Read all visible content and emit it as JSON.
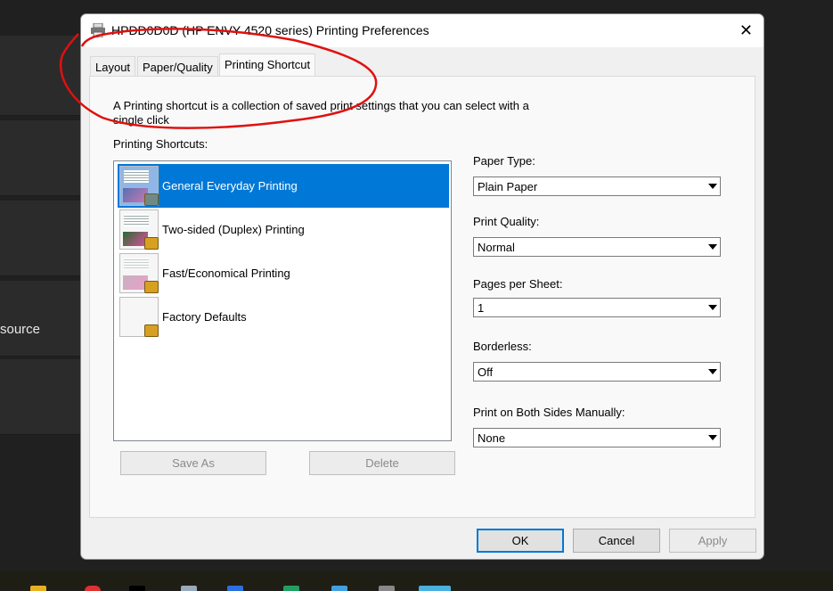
{
  "background": {
    "partial_text": "source"
  },
  "dialog": {
    "title": "HPDD0D0D (HP ENVY 4520 series) Printing Preferences",
    "tabs": [
      {
        "label": "Layout"
      },
      {
        "label": "Paper/Quality"
      },
      {
        "label": "Printing Shortcut",
        "active": true
      }
    ],
    "description": "A Printing shortcut is a collection of saved print settings that you can select with a single click",
    "shortcuts_label": "Printing Shortcuts:",
    "shortcuts": [
      {
        "label": "General Everyday Printing",
        "selected": true
      },
      {
        "label": "Two-sided (Duplex) Printing"
      },
      {
        "label": "Fast/Economical Printing"
      },
      {
        "label": "Factory Defaults"
      }
    ],
    "save_as": "Save As",
    "delete": "Delete",
    "fields": [
      {
        "label": "Paper Type:",
        "value": "Plain Paper"
      },
      {
        "label": "Print Quality:",
        "value": "Normal"
      },
      {
        "label": "Pages per Sheet:",
        "value": "1"
      },
      {
        "label": "Borderless:",
        "value": "Off"
      },
      {
        "label": "Print on Both Sides Manually:",
        "value": "None"
      }
    ],
    "ok": "OK",
    "cancel": "Cancel",
    "apply": "Apply"
  },
  "colors": {
    "selection": "#0078d7",
    "annotation": "#e01010"
  }
}
